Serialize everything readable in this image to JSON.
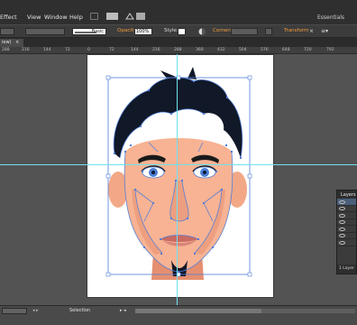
{
  "app": {
    "menu": [
      "Effect",
      "View",
      "Window",
      "Help"
    ],
    "workspace": "Essentials"
  },
  "control": {
    "stroke_profile": "Basic",
    "opacity_label": "Opacity:",
    "opacity_value": "100%",
    "style_label": "Style:",
    "corners_label": "Corners:",
    "transform_label": "Transform"
  },
  "document": {
    "tab_label": "iew)"
  },
  "ruler": [
    "288",
    "216",
    "144",
    "72",
    "0",
    "72",
    "144",
    "216",
    "288",
    "360",
    "432",
    "504",
    "576",
    "648",
    "720",
    "792"
  ],
  "layers_panel": {
    "title": "Layers",
    "footer": "1 Layer"
  },
  "status": {
    "tool": "Selection"
  },
  "colors": {
    "guide": "#6ee2ee",
    "accent_orange": "#f39c3c",
    "selection_blue": "#4f7dd9",
    "skin": "#f6b08f",
    "hair": "#111827"
  }
}
